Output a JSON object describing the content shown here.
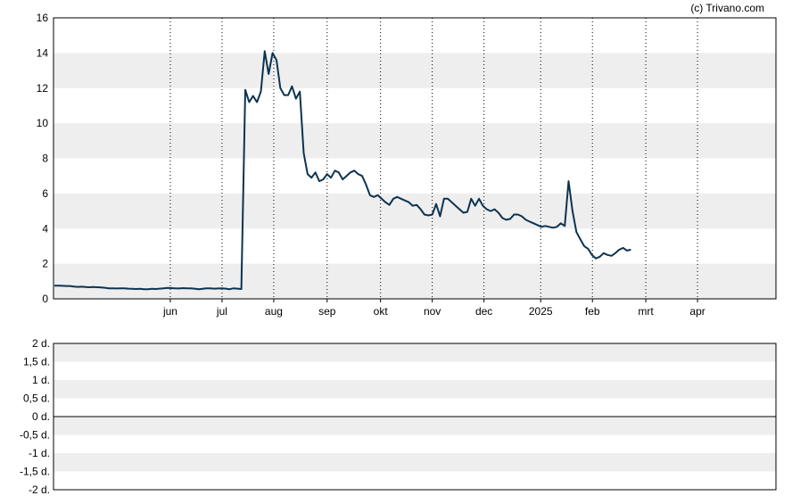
{
  "copyright": "(c) Trivano.com",
  "chart_data": [
    {
      "type": "line",
      "title": "",
      "xlabel": "",
      "ylabel": "",
      "ylim": [
        0,
        16
      ],
      "y_ticks": [
        0,
        2,
        4,
        6,
        8,
        10,
        12,
        14,
        16
      ],
      "x_ticks": [
        "jun",
        "jul",
        "aug",
        "sep",
        "okt",
        "nov",
        "dec",
        "2025",
        "feb",
        "mrt",
        "apr"
      ],
      "grid": "vertical dotted lines at month ticks, alternating horizontal bands",
      "line_color": "#0d3350",
      "band_color": "#eeeeee",
      "series": [
        {
          "x_index": [
            0,
            2,
            4,
            6,
            8,
            10,
            12,
            14,
            16,
            18,
            20,
            22,
            24,
            26,
            28,
            30,
            32,
            34,
            36,
            38,
            40,
            42,
            44,
            46,
            48,
            50,
            52,
            54,
            56,
            58,
            60,
            62,
            64,
            66,
            68,
            70,
            72,
            74,
            76,
            78,
            80,
            82,
            84,
            86,
            88,
            90,
            92,
            94,
            96,
            98,
            100,
            102,
            104,
            106,
            108,
            110,
            112,
            114,
            116,
            118,
            120,
            122,
            124,
            126,
            128,
            130,
            132,
            134,
            136,
            138,
            140,
            142,
            144,
            146,
            148,
            150,
            152,
            154,
            156,
            158,
            160,
            162,
            164,
            166,
            168,
            170,
            172,
            174,
            176,
            178,
            180,
            182,
            184,
            186,
            188,
            190,
            192,
            194,
            196,
            198,
            200,
            202,
            204,
            206,
            208,
            210,
            212,
            214,
            216,
            218,
            220,
            222,
            224,
            226,
            228,
            230,
            232,
            234,
            236,
            238,
            240,
            242,
            244,
            246,
            248,
            250,
            252,
            254,
            256,
            258,
            260,
            262,
            264,
            266,
            268,
            270,
            272,
            274,
            276,
            278,
            280,
            282,
            284,
            286,
            288,
            290,
            292,
            294,
            296,
            298,
            300,
            302,
            304,
            306,
            308,
            310,
            312,
            314,
            316,
            318,
            320,
            322,
            324,
            326,
            328,
            330,
            332,
            334,
            336,
            338,
            340,
            342,
            344,
            346,
            348,
            350,
            352,
            354,
            356,
            358,
            360,
            362,
            364,
            366,
            368,
            370
          ],
          "values": [
            0.75,
            0.75,
            0.74,
            0.73,
            0.73,
            0.7,
            0.68,
            0.69,
            0.67,
            0.66,
            0.67,
            0.66,
            0.65,
            0.63,
            0.6,
            0.6,
            0.59,
            0.6,
            0.6,
            0.58,
            0.57,
            0.56,
            0.57,
            0.55,
            0.55,
            0.57,
            0.56,
            0.58,
            0.6,
            0.62,
            0.61,
            0.6,
            0.59,
            0.61,
            0.6,
            0.6,
            0.58,
            0.55,
            0.57,
            0.6,
            0.6,
            0.58,
            0.59,
            0.6,
            0.58,
            0.55,
            0.6,
            0.58,
            0.56,
            11.9,
            11.2,
            11.55,
            11.2,
            11.8,
            14.1,
            12.8,
            14.0,
            13.6,
            12.0,
            11.6,
            11.6,
            12.1,
            11.4,
            11.8,
            8.3,
            7.1,
            6.9,
            7.2,
            6.7,
            6.8,
            7.1,
            6.9,
            7.3,
            7.2,
            6.8,
            7.0,
            7.2,
            7.3,
            7.1,
            7.0,
            6.5,
            5.9,
            5.8,
            5.9,
            5.7,
            5.5,
            5.35,
            5.7,
            5.8,
            5.7,
            5.6,
            5.5,
            5.3,
            5.35,
            5.1,
            4.8,
            4.75,
            4.8,
            5.4,
            4.7,
            5.7,
            5.7,
            5.5,
            5.3,
            5.1,
            4.9,
            4.95,
            5.7,
            5.3,
            5.7,
            5.3,
            5.1,
            5.0,
            5.1,
            4.9,
            4.6,
            4.5,
            4.55,
            4.8,
            4.8,
            4.7,
            4.5,
            4.4,
            4.3,
            4.2,
            4.1,
            4.15,
            4.1,
            4.05,
            4.1,
            4.3,
            4.15,
            6.7,
            5.0,
            3.8,
            3.4,
            3.0,
            2.85,
            2.5,
            2.3,
            2.4,
            2.6,
            2.5,
            2.45,
            2.6,
            2.8,
            2.9,
            2.75,
            2.8
          ]
        }
      ]
    },
    {
      "type": "line",
      "title": "",
      "xlabel": "",
      "ylabel": "",
      "ylim": [
        -2,
        2
      ],
      "y_ticks": [
        "2 d.",
        "1,5 d.",
        "1 d.",
        "0,5 d.",
        "0 d.",
        "-0,5 d.",
        "-1 d.",
        "-1,5 d.",
        "-2 d."
      ],
      "grid": "alternating horizontal bands, zero line",
      "series": []
    }
  ]
}
